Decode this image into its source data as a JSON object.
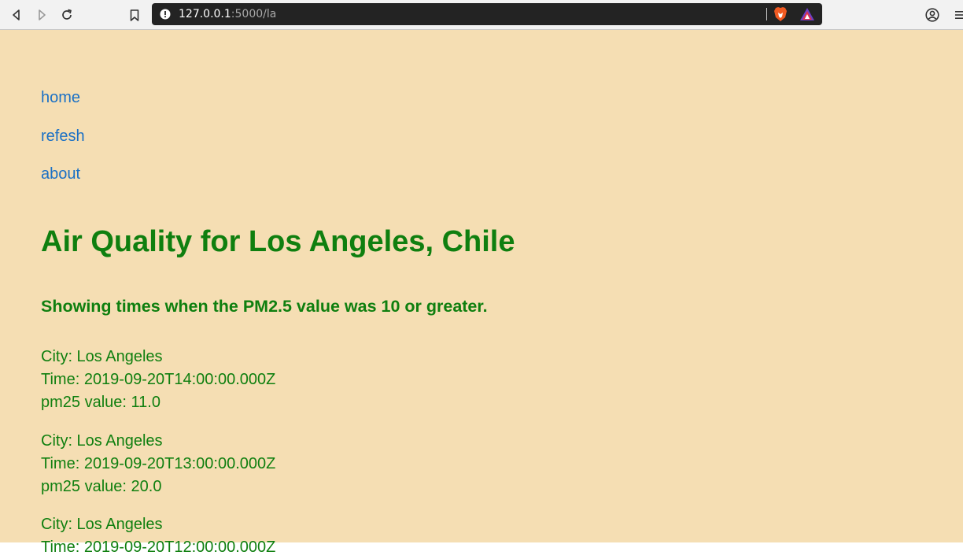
{
  "browser": {
    "url_host": "127.0.0.1",
    "url_path": ":5000/la"
  },
  "nav": {
    "home": "home",
    "refresh": "refesh",
    "about": "about"
  },
  "main": {
    "title": "Air Quality for Los Angeles, Chile",
    "subtitle": "Showing times when the PM2.5 value was 10 or greater.",
    "records": [
      {
        "city": "City: Los Angeles",
        "time": "Time: 2019-09-20T14:00:00.000Z",
        "pm25": "pm25 value: 11.0"
      },
      {
        "city": "City: Los Angeles",
        "time": "Time: 2019-09-20T13:00:00.000Z",
        "pm25": "pm25 value: 20.0"
      },
      {
        "city": "City: Los Angeles",
        "time": "Time: 2019-09-20T12:00:00.000Z",
        "pm25": ""
      }
    ]
  },
  "colors": {
    "background": "#f5deb3",
    "heading": "#0f7f0f",
    "link": "#1a70c5"
  }
}
